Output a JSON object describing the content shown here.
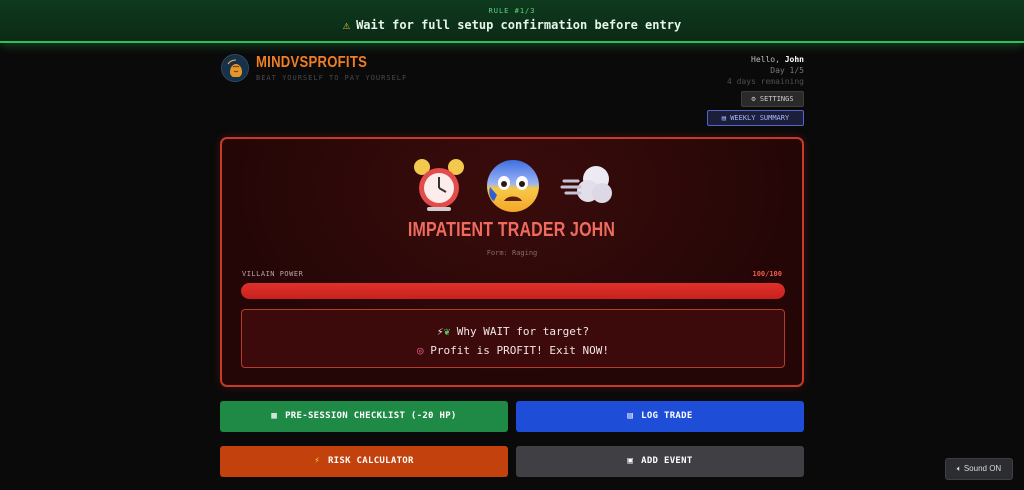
{
  "rule": {
    "counter": "RULE #1/3",
    "warning_icon": "warning-icon",
    "text": "Wait for full setup confirmation before entry"
  },
  "brand": {
    "name": "MINDVSPROFITS",
    "tagline": "BEAT YOURSELF TO PAY YOURSELF",
    "logo_icon": "brain-logo-icon"
  },
  "user": {
    "greeting": "Hello,",
    "name": "John",
    "day": "Day 1/5",
    "remaining": "4 days remaining"
  },
  "header_buttons": {
    "settings": "SETTINGS",
    "weekly_summary": "WEEKLY SUMMARY"
  },
  "villain": {
    "emojis": [
      "alarm-clock-icon",
      "anxious-face-icon",
      "dash-cloud-icon"
    ],
    "name": "IMPATIENT TRADER JOHN",
    "form": "Form: Raging",
    "power_label": "VILLAIN POWER",
    "power_value": "100/100",
    "power_fraction": 1.0,
    "taunt_line1": "Why WAIT for target?",
    "taunt_line2": "Profit is PROFIT! Exit NOW!"
  },
  "actions": {
    "checklist": "PRE-SESSION CHECKLIST (-20 HP)",
    "log_trade": "LOG TRADE",
    "risk_calculator": "RISK CALCULATOR",
    "add_event": "ADD EVENT"
  },
  "sound": {
    "label": "Sound ON"
  },
  "colors": {
    "rule_green": "#2fbf55",
    "brand_orange": "#f07e22",
    "villain_red": "#ee6b5e",
    "checklist_green": "#1f8a45",
    "log_blue": "#1e4ed8",
    "risk_orange": "#c2410c",
    "event_gray": "#3f3f44"
  }
}
